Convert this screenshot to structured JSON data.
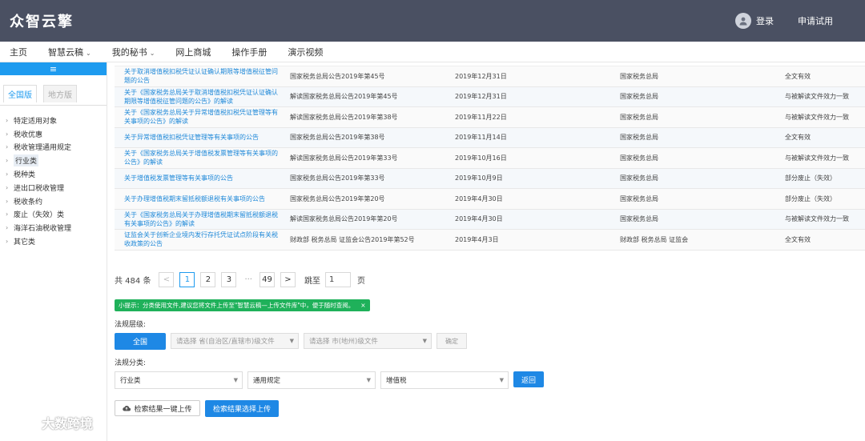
{
  "header": {
    "logo": "众智云擎",
    "login": "登录",
    "trial": "申请试用"
  },
  "nav": [
    {
      "label": "主页",
      "dropdown": false
    },
    {
      "label": "智慧云稿",
      "dropdown": true
    },
    {
      "label": "我的秘书",
      "dropdown": true
    },
    {
      "label": "网上商城",
      "dropdown": false
    },
    {
      "label": "操作手册",
      "dropdown": false
    },
    {
      "label": "演示视频",
      "dropdown": false
    }
  ],
  "sidebar": {
    "menu_icon": "≡",
    "tabs": [
      "全国版",
      "地方版"
    ],
    "items": [
      "特定适用对象",
      "税收优惠",
      "税收管理通用规定",
      "行业类",
      "税种类",
      "进出口税收管理",
      "税收条约",
      "废止（失效）类",
      "海洋石油税收管理",
      "其它类"
    ]
  },
  "table": {
    "rows": [
      [
        "关于取消增值税扣税凭证认证确认期限等增值税征管问题的公告",
        "国家税务总局公告2019年第45号",
        "2019年12月31日",
        "国家税务总局",
        "全文有效"
      ],
      [
        "关于《国家税务总局关于取消增值税扣税凭证认证确认期限等增值税征管问题的公告》的解读",
        "解读国家税务总局公告2019年第45号",
        "2019年12月31日",
        "国家税务总局",
        "与被解读文件效力一致"
      ],
      [
        "关于《国家税务总局关于异常增值税扣税凭证管理等有关事项的公告》的解读",
        "解读国家税务总局公告2019年第38号",
        "2019年11月22日",
        "国家税务总局",
        "与被解读文件效力一致"
      ],
      [
        "关于异常增值税扣税凭证管理等有关事项的公告",
        "国家税务总局公告2019年第38号",
        "2019年11月14日",
        "国家税务总局",
        "全文有效"
      ],
      [
        "关于《国家税务总局关于增值税发票管理等有关事项的公告》的解读",
        "解读国家税务总局公告2019年第33号",
        "2019年10月16日",
        "国家税务总局",
        "与被解读文件效力一致"
      ],
      [
        "关于增值税发票管理等有关事项的公告",
        "国家税务总局公告2019年第33号",
        "2019年10月9日",
        "国家税务总局",
        "部分废止（失效）"
      ],
      [
        "关于办理增值税期末留抵税额退税有关事项的公告",
        "国家税务总局公告2019年第20号",
        "2019年4月30日",
        "国家税务总局",
        "部分废止（失效）"
      ],
      [
        "关于《国家税务总局关于办理增值税期末留抵税额退税有关事项的公告》的解读",
        "解读国家税务总局公告2019年第20号",
        "2019年4月30日",
        "国家税务总局",
        "与被解读文件效力一致"
      ],
      [
        "证监会关于创新企业境内发行存托凭证试点阶段有关税收政策的公告",
        "财政部 税务总局 证监会公告2019年第52号",
        "2019年4月3日",
        "财政部 税务总局 证监会",
        "全文有效"
      ]
    ]
  },
  "pagination": {
    "total": "共 484 条",
    "prev": "<",
    "pages": [
      "1",
      "2",
      "3"
    ],
    "ellipsis": "···",
    "last": "49",
    "next": ">",
    "goto_label": "跳至",
    "goto_value": "1",
    "page_unit": "页",
    "current": "1"
  },
  "tip": {
    "text": "小提示：分类使用文件,建议您将文件上传至\"智慧云稿—上传文件库\"中，便于随时查阅。",
    "close": "×"
  },
  "filters": {
    "level_label": "法规层级:",
    "all_button": "全国",
    "province_placeholder": "请选择 省(自治区/直辖市)级文件",
    "city_placeholder": "请选择 市(地州)级文件",
    "confirm": "确定",
    "category_label": "法规分类:",
    "cat1": "行业类",
    "cat2": "通用规定",
    "cat3": "增值税",
    "back": "返回"
  },
  "actions": {
    "upload_all": "检索结果一键上传",
    "upload_selected": "检索结果选择上传"
  },
  "watermark": {
    "text": "大数跨境"
  }
}
